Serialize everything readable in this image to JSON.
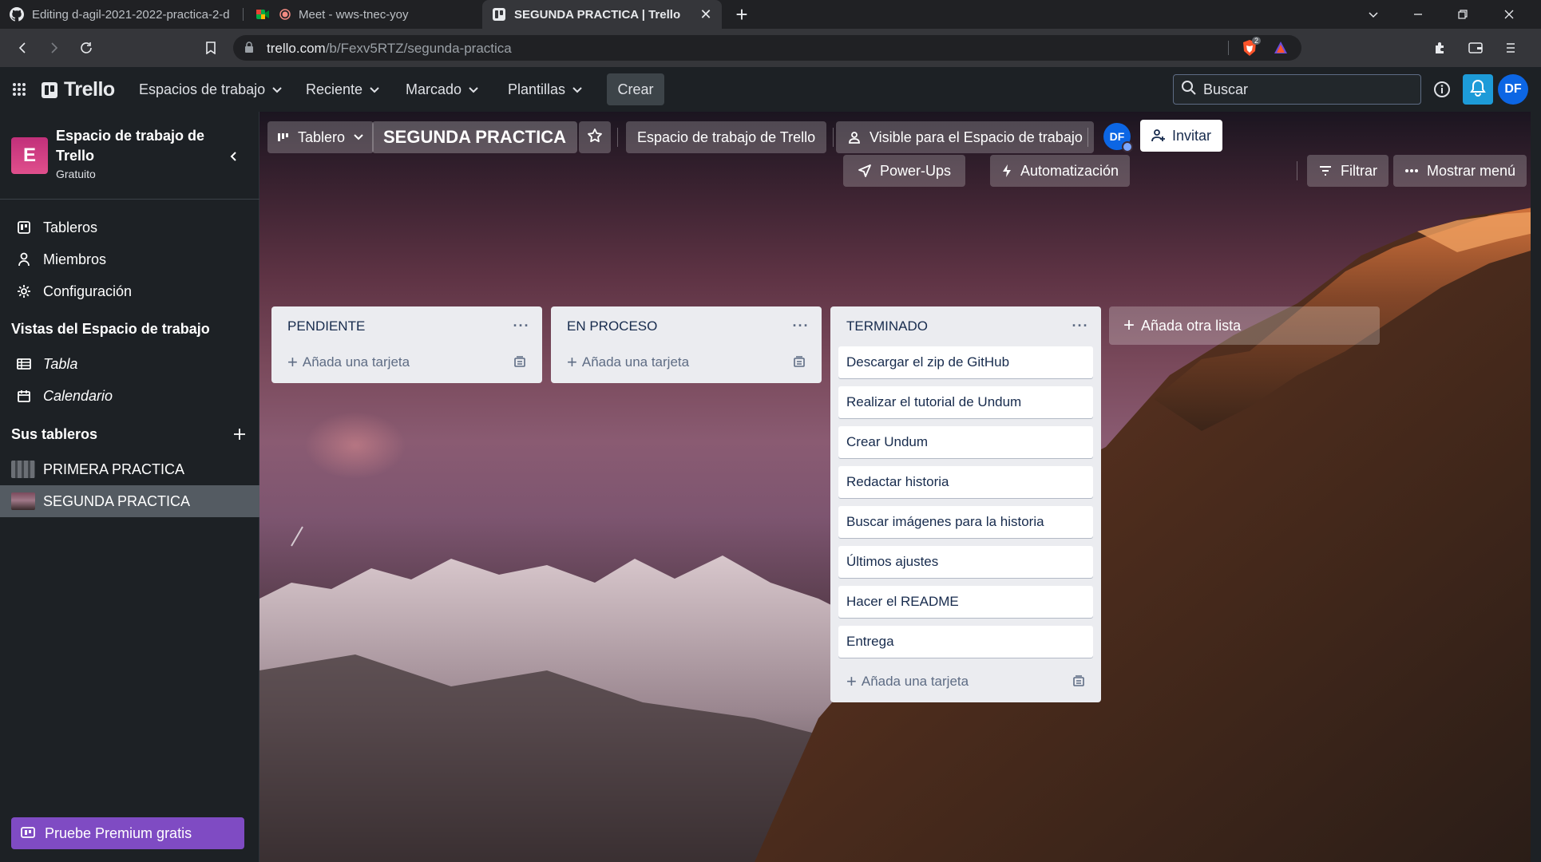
{
  "browser": {
    "tabs": [
      {
        "title": "Editing d-agil-2021-2022-practica-2-d",
        "active": false
      },
      {
        "title": "Meet - wws-tnec-yoy",
        "active": false
      },
      {
        "title": "SEGUNDA PRACTICA | Trello",
        "active": true
      }
    ],
    "url_domain": "trello.com",
    "url_path": "/b/Fexv5RTZ/segunda-practica",
    "shield_count": "2"
  },
  "header": {
    "brand": "Trello",
    "menu": [
      "Espacios de trabajo",
      "Reciente",
      "Marcado",
      "Plantillas"
    ],
    "create_label": "Crear",
    "search_placeholder": "Buscar",
    "user_initials": "DF"
  },
  "sidebar": {
    "workspace_name": "Espacio de trabajo de Trello",
    "workspace_initial": "E",
    "workspace_plan": "Gratuito",
    "nav": [
      {
        "label": "Tableros",
        "icon": "board-icon"
      },
      {
        "label": "Miembros",
        "icon": "person-icon"
      },
      {
        "label": "Configuración",
        "icon": "gear-icon"
      }
    ],
    "views_heading": "Vistas del Espacio de trabajo",
    "views": [
      {
        "label": "Tabla",
        "icon": "table-icon"
      },
      {
        "label": "Calendario",
        "icon": "calendar-icon"
      }
    ],
    "boards_heading": "Sus tableros",
    "boards": [
      {
        "label": "PRIMERA PRACTICA",
        "selected": false
      },
      {
        "label": "SEGUNDA PRACTICA",
        "selected": true
      }
    ],
    "premium_label": "Pruebe Premium gratis"
  },
  "board": {
    "view_label": "Tablero",
    "title": "SEGUNDA PRACTICA",
    "workspace_button": "Espacio de trabajo de Trello",
    "visibility_button": "Visible para el Espacio de trabajo",
    "member_initials": "DF",
    "invite_label": "Invitar",
    "powerups_label": "Power-Ups",
    "automation_label": "Automatización",
    "filter_label": "Filtrar",
    "menu_label": "Mostrar menú",
    "add_list_label": "Añada otra lista",
    "add_card_label": "Añada una tarjeta",
    "lists": [
      {
        "title": "PENDIENTE",
        "cards": []
      },
      {
        "title": "EN PROCESO",
        "cards": []
      },
      {
        "title": "TERMINADO",
        "cards": [
          "Descargar el zip de GitHub",
          "Realizar el tutorial de Undum",
          "Crear Undum",
          "Redactar historia",
          "Buscar imágenes para la historia",
          "Últimos ajustes",
          "Hacer el README",
          "Entrega"
        ]
      }
    ]
  },
  "colors": {
    "header_bg": "#1d2125",
    "list_bg": "#ebecf0",
    "premium": "#7f4bc3",
    "accent_blue": "#0c66e4"
  }
}
